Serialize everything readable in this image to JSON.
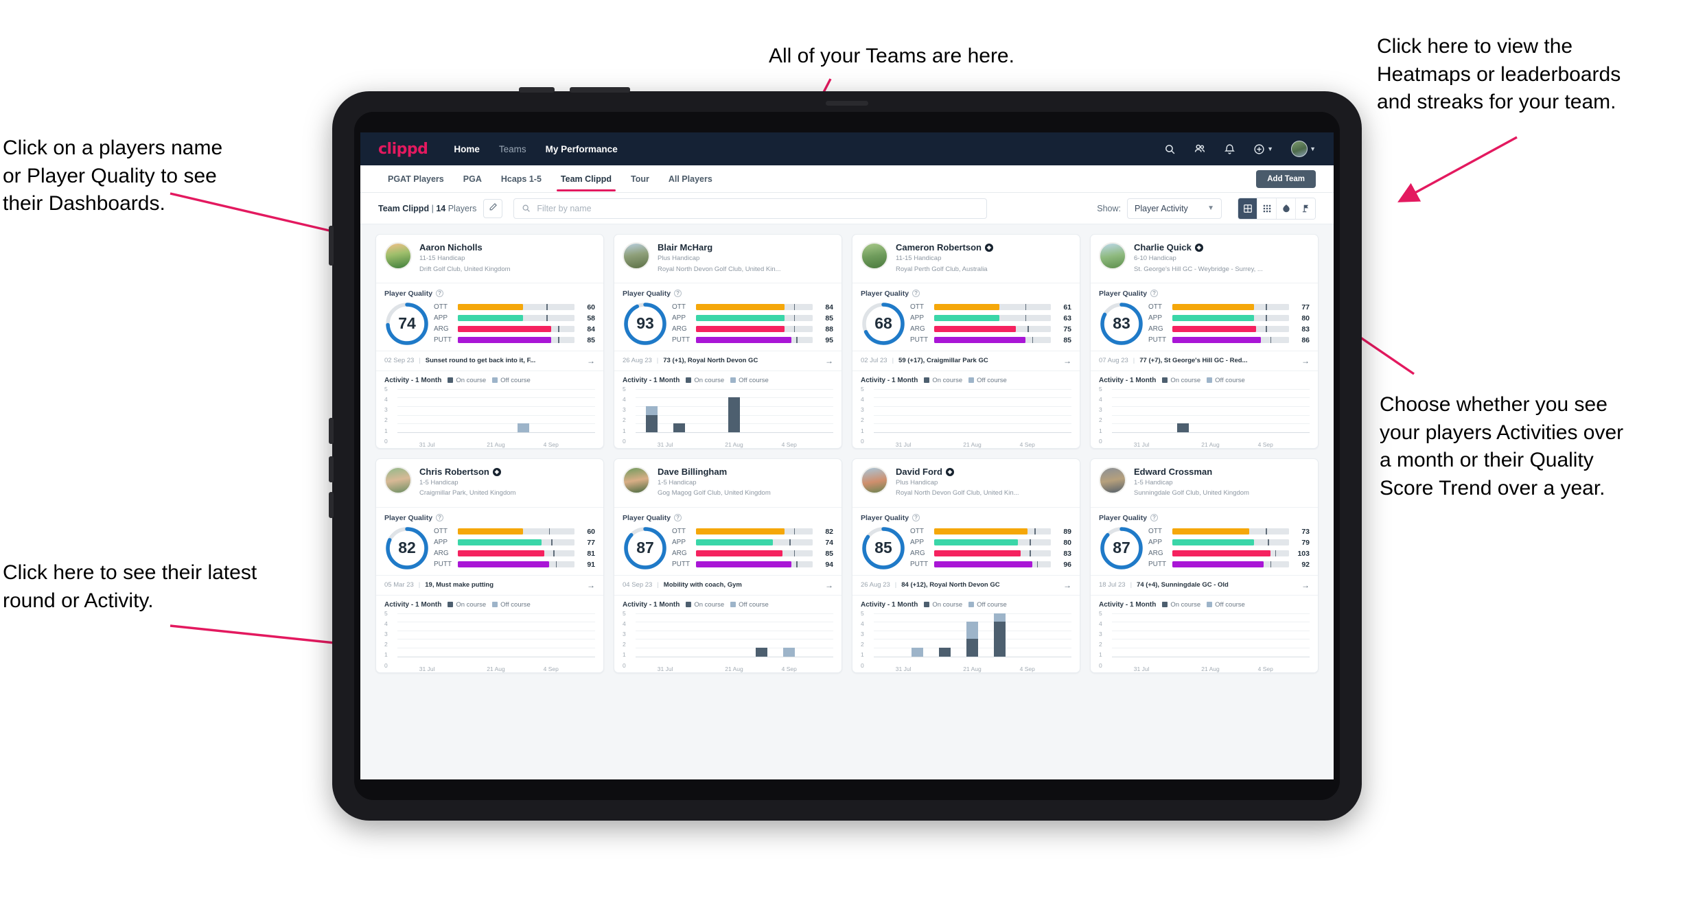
{
  "annotations": [
    {
      "id": "teams",
      "text": "All of your Teams are here."
    },
    {
      "id": "heatmaps",
      "text": "Click here to view the\nHeatmaps or leaderboards\nand streaks for your team."
    },
    {
      "id": "dashboards",
      "text": "Click on a players name\nor Player Quality to see\ntheir Dashboards."
    },
    {
      "id": "activity-choice",
      "text": "Choose whether you see\nyour players Activities over\na month or their Quality\nScore Trend over a year."
    },
    {
      "id": "latest-round",
      "text": "Click here to see their latest\nround or Activity."
    }
  ],
  "colors": {
    "brand": "#e3195f",
    "navbar": "#152235",
    "ring": "#1f7ac8",
    "ott": "#f5a70a",
    "app": "#3ad6a8",
    "arg": "#f5225f",
    "putt": "#a916d6",
    "on_course": "#4d5f6f",
    "off_course": "#9db4c9"
  },
  "topnav": {
    "logo": "clippd",
    "links": [
      {
        "label": "Home",
        "active": true
      },
      {
        "label": "Teams",
        "active": false
      },
      {
        "label": "My Performance",
        "active": true
      }
    ],
    "icons": [
      {
        "name": "search-icon"
      },
      {
        "name": "people-icon"
      },
      {
        "name": "bell-icon"
      },
      {
        "name": "plus-circle-icon"
      },
      {
        "name": "avatar"
      }
    ]
  },
  "tabs": [
    {
      "label": "PGAT Players",
      "active": false
    },
    {
      "label": "PGA",
      "active": false
    },
    {
      "label": "Hcaps 1-5",
      "active": false
    },
    {
      "label": "Team Clippd",
      "active": true
    },
    {
      "label": "Tour",
      "active": false
    },
    {
      "label": "All Players",
      "active": false
    }
  ],
  "add_team_label": "Add Team",
  "filterbar": {
    "team_name": "Team Clippd",
    "separator": "|",
    "player_count": "14",
    "players_word": "Players",
    "edit_icon": "pencil-icon",
    "search_placeholder": "Filter by name",
    "show_label": "Show:",
    "show_value": "Player Activity",
    "show_options": [
      "Player Activity",
      "Quality Score Trend"
    ],
    "view_buttons": [
      {
        "name": "grid-large-icon",
        "active": true
      },
      {
        "name": "grid-small-icon",
        "active": false
      },
      {
        "name": "heatmap-icon",
        "active": false
      },
      {
        "name": "leaderboard-flag-icon",
        "active": false
      }
    ]
  },
  "card_labels": {
    "player_quality": "Player Quality",
    "activity_title": "Activity - 1 Month",
    "legend_on": "On course",
    "legend_off": "Off course",
    "metric_labels": [
      "OTT",
      "APP",
      "ARG",
      "PUTT"
    ]
  },
  "chart_data": {
    "type": "bar",
    "title": "Activity - 1 Month",
    "ylabel": "",
    "xlabel": "",
    "ylim": [
      0,
      5
    ],
    "yticks": [
      0,
      1,
      2,
      3,
      4,
      5
    ],
    "xticks": [
      "31 Jul",
      "21 Aug",
      "4 Sep"
    ],
    "legend": [
      "On course",
      "Off course"
    ],
    "legend_position": "top",
    "grid": true,
    "stacked": true,
    "slots": 7
  },
  "players": [
    {
      "name": "Aaron Nicholls",
      "verified": false,
      "handicap": "11-15 Handicap",
      "club": "Drift Golf Club, United Kingdom",
      "quality": "74",
      "ring_pct": 74,
      "metrics": [
        {
          "label": "OTT",
          "value": "60",
          "fill": 56,
          "tick": 76
        },
        {
          "label": "APP",
          "value": "58",
          "fill": 56,
          "tick": 76
        },
        {
          "label": "ARG",
          "value": "84",
          "fill": 80,
          "tick": 86
        },
        {
          "label": "PUTT",
          "value": "85",
          "fill": 80,
          "tick": 86
        }
      ],
      "round_date": "02 Sep 23",
      "round_text": "Sunset round to get back into it, F...",
      "activity": [
        {
          "on": 0,
          "off": 0
        },
        {
          "on": 0,
          "off": 0
        },
        {
          "on": 0,
          "off": 0
        },
        {
          "on": 0,
          "off": 0
        },
        {
          "on": 0,
          "off": 1
        },
        {
          "on": 0,
          "off": 0
        },
        {
          "on": 0,
          "off": 0
        }
      ]
    },
    {
      "name": "Blair McHarg",
      "verified": false,
      "handicap": "Plus Handicap",
      "club": "Royal North Devon Golf Club, United Kin...",
      "quality": "93",
      "ring_pct": 93,
      "metrics": [
        {
          "label": "OTT",
          "value": "84",
          "fill": 76,
          "tick": 84
        },
        {
          "label": "APP",
          "value": "85",
          "fill": 76,
          "tick": 84
        },
        {
          "label": "ARG",
          "value": "88",
          "fill": 76,
          "tick": 84
        },
        {
          "label": "PUTT",
          "value": "95",
          "fill": 82,
          "tick": 86
        }
      ],
      "round_date": "26 Aug 23",
      "round_text": "73 (+1), Royal North Devon GC",
      "activity": [
        {
          "on": 2,
          "off": 1
        },
        {
          "on": 1,
          "off": 0
        },
        {
          "on": 0,
          "off": 0
        },
        {
          "on": 4,
          "off": 0
        },
        {
          "on": 0,
          "off": 0
        },
        {
          "on": 0,
          "off": 0
        },
        {
          "on": 0,
          "off": 0
        }
      ]
    },
    {
      "name": "Cameron Robertson",
      "verified": true,
      "handicap": "11-15 Handicap",
      "club": "Royal Perth Golf Club, Australia",
      "quality": "68",
      "ring_pct": 68,
      "metrics": [
        {
          "label": "OTT",
          "value": "61",
          "fill": 56,
          "tick": 78
        },
        {
          "label": "APP",
          "value": "63",
          "fill": 56,
          "tick": 78
        },
        {
          "label": "ARG",
          "value": "75",
          "fill": 70,
          "tick": 80
        },
        {
          "label": "PUTT",
          "value": "85",
          "fill": 78,
          "tick": 84
        }
      ],
      "round_date": "02 Jul 23",
      "round_text": "59 (+17), Craigmillar Park GC",
      "activity": [
        {
          "on": 0,
          "off": 0
        },
        {
          "on": 0,
          "off": 0
        },
        {
          "on": 0,
          "off": 0
        },
        {
          "on": 0,
          "off": 0
        },
        {
          "on": 0,
          "off": 0
        },
        {
          "on": 0,
          "off": 0
        },
        {
          "on": 0,
          "off": 0
        }
      ]
    },
    {
      "name": "Charlie Quick",
      "verified": true,
      "handicap": "6-10 Handicap",
      "club": "St. George's Hill GC - Weybridge - Surrey, ...",
      "quality": "83",
      "ring_pct": 83,
      "metrics": [
        {
          "label": "OTT",
          "value": "77",
          "fill": 70,
          "tick": 80
        },
        {
          "label": "APP",
          "value": "80",
          "fill": 70,
          "tick": 80
        },
        {
          "label": "ARG",
          "value": "83",
          "fill": 72,
          "tick": 80
        },
        {
          "label": "PUTT",
          "value": "86",
          "fill": 76,
          "tick": 84
        }
      ],
      "round_date": "07 Aug 23",
      "round_text": "77 (+7), St George's Hill GC - Red...",
      "activity": [
        {
          "on": 0,
          "off": 0
        },
        {
          "on": 0,
          "off": 0
        },
        {
          "on": 1,
          "off": 0
        },
        {
          "on": 0,
          "off": 0
        },
        {
          "on": 0,
          "off": 0
        },
        {
          "on": 0,
          "off": 0
        },
        {
          "on": 0,
          "off": 0
        }
      ]
    },
    {
      "name": "Chris Robertson",
      "verified": true,
      "handicap": "1-5 Handicap",
      "club": "Craigmillar Park, United Kingdom",
      "quality": "82",
      "ring_pct": 82,
      "metrics": [
        {
          "label": "OTT",
          "value": "60",
          "fill": 56,
          "tick": 78
        },
        {
          "label": "APP",
          "value": "77",
          "fill": 72,
          "tick": 80
        },
        {
          "label": "ARG",
          "value": "81",
          "fill": 74,
          "tick": 82
        },
        {
          "label": "PUTT",
          "value": "91",
          "fill": 78,
          "tick": 84
        }
      ],
      "round_date": "05 Mar 23",
      "round_text": "19, Must make putting",
      "activity": [
        {
          "on": 0,
          "off": 0
        },
        {
          "on": 0,
          "off": 0
        },
        {
          "on": 0,
          "off": 0
        },
        {
          "on": 0,
          "off": 0
        },
        {
          "on": 0,
          "off": 0
        },
        {
          "on": 0,
          "off": 0
        },
        {
          "on": 0,
          "off": 0
        }
      ]
    },
    {
      "name": "Dave Billingham",
      "verified": false,
      "handicap": "1-5 Handicap",
      "club": "Gog Magog Golf Club, United Kingdom",
      "quality": "87",
      "ring_pct": 87,
      "metrics": [
        {
          "label": "OTT",
          "value": "82",
          "fill": 76,
          "tick": 84
        },
        {
          "label": "APP",
          "value": "74",
          "fill": 66,
          "tick": 80
        },
        {
          "label": "ARG",
          "value": "85",
          "fill": 74,
          "tick": 84
        },
        {
          "label": "PUTT",
          "value": "94",
          "fill": 82,
          "tick": 86
        }
      ],
      "round_date": "04 Sep 23",
      "round_text": "Mobility with coach, Gym",
      "activity": [
        {
          "on": 0,
          "off": 0
        },
        {
          "on": 0,
          "off": 0
        },
        {
          "on": 0,
          "off": 0
        },
        {
          "on": 0,
          "off": 0
        },
        {
          "on": 1,
          "off": 0
        },
        {
          "on": 0,
          "off": 1
        },
        {
          "on": 0,
          "off": 0
        }
      ]
    },
    {
      "name": "David Ford",
      "verified": true,
      "handicap": "Plus Handicap",
      "club": "Royal North Devon Golf Club, United Kin...",
      "quality": "85",
      "ring_pct": 85,
      "metrics": [
        {
          "label": "OTT",
          "value": "89",
          "fill": 80,
          "tick": 86
        },
        {
          "label": "APP",
          "value": "80",
          "fill": 72,
          "tick": 82
        },
        {
          "label": "ARG",
          "value": "83",
          "fill": 74,
          "tick": 82
        },
        {
          "label": "PUTT",
          "value": "96",
          "fill": 84,
          "tick": 88
        }
      ],
      "round_date": "26 Aug 23",
      "round_text": "84 (+12), Royal North Devon GC",
      "activity": [
        {
          "on": 0,
          "off": 0
        },
        {
          "on": 0,
          "off": 1
        },
        {
          "on": 1,
          "off": 0
        },
        {
          "on": 2,
          "off": 2
        },
        {
          "on": 4,
          "off": 1
        },
        {
          "on": 0,
          "off": 0
        },
        {
          "on": 0,
          "off": 0
        }
      ]
    },
    {
      "name": "Edward Crossman",
      "verified": false,
      "handicap": "1-5 Handicap",
      "club": "Sunningdale Golf Club, United Kingdom",
      "quality": "87",
      "ring_pct": 87,
      "metrics": [
        {
          "label": "OTT",
          "value": "73",
          "fill": 66,
          "tick": 80
        },
        {
          "label": "APP",
          "value": "79",
          "fill": 70,
          "tick": 82
        },
        {
          "label": "ARG",
          "value": "103",
          "fill": 84,
          "tick": 88
        },
        {
          "label": "PUTT",
          "value": "92",
          "fill": 78,
          "tick": 84
        }
      ],
      "round_date": "18 Jul 23",
      "round_text": "74 (+4), Sunningdale GC - Old",
      "activity": [
        {
          "on": 0,
          "off": 0
        },
        {
          "on": 0,
          "off": 0
        },
        {
          "on": 0,
          "off": 0
        },
        {
          "on": 0,
          "off": 0
        },
        {
          "on": 0,
          "off": 0
        },
        {
          "on": 0,
          "off": 0
        },
        {
          "on": 0,
          "off": 0
        }
      ]
    }
  ]
}
